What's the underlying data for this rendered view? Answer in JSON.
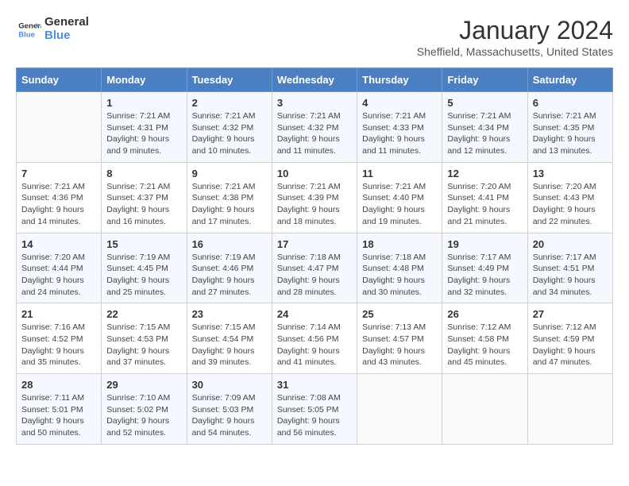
{
  "header": {
    "logo_line1": "General",
    "logo_line2": "Blue",
    "month": "January 2024",
    "location": "Sheffield, Massachusetts, United States"
  },
  "days_of_week": [
    "Sunday",
    "Monday",
    "Tuesday",
    "Wednesday",
    "Thursday",
    "Friday",
    "Saturday"
  ],
  "weeks": [
    [
      {
        "day": "",
        "sunrise": "",
        "sunset": "",
        "daylight": ""
      },
      {
        "day": "1",
        "sunrise": "Sunrise: 7:21 AM",
        "sunset": "Sunset: 4:31 PM",
        "daylight": "Daylight: 9 hours and 9 minutes."
      },
      {
        "day": "2",
        "sunrise": "Sunrise: 7:21 AM",
        "sunset": "Sunset: 4:32 PM",
        "daylight": "Daylight: 9 hours and 10 minutes."
      },
      {
        "day": "3",
        "sunrise": "Sunrise: 7:21 AM",
        "sunset": "Sunset: 4:32 PM",
        "daylight": "Daylight: 9 hours and 11 minutes."
      },
      {
        "day": "4",
        "sunrise": "Sunrise: 7:21 AM",
        "sunset": "Sunset: 4:33 PM",
        "daylight": "Daylight: 9 hours and 11 minutes."
      },
      {
        "day": "5",
        "sunrise": "Sunrise: 7:21 AM",
        "sunset": "Sunset: 4:34 PM",
        "daylight": "Daylight: 9 hours and 12 minutes."
      },
      {
        "day": "6",
        "sunrise": "Sunrise: 7:21 AM",
        "sunset": "Sunset: 4:35 PM",
        "daylight": "Daylight: 9 hours and 13 minutes."
      }
    ],
    [
      {
        "day": "7",
        "sunrise": "Sunrise: 7:21 AM",
        "sunset": "Sunset: 4:36 PM",
        "daylight": "Daylight: 9 hours and 14 minutes."
      },
      {
        "day": "8",
        "sunrise": "Sunrise: 7:21 AM",
        "sunset": "Sunset: 4:37 PM",
        "daylight": "Daylight: 9 hours and 16 minutes."
      },
      {
        "day": "9",
        "sunrise": "Sunrise: 7:21 AM",
        "sunset": "Sunset: 4:38 PM",
        "daylight": "Daylight: 9 hours and 17 minutes."
      },
      {
        "day": "10",
        "sunrise": "Sunrise: 7:21 AM",
        "sunset": "Sunset: 4:39 PM",
        "daylight": "Daylight: 9 hours and 18 minutes."
      },
      {
        "day": "11",
        "sunrise": "Sunrise: 7:21 AM",
        "sunset": "Sunset: 4:40 PM",
        "daylight": "Daylight: 9 hours and 19 minutes."
      },
      {
        "day": "12",
        "sunrise": "Sunrise: 7:20 AM",
        "sunset": "Sunset: 4:41 PM",
        "daylight": "Daylight: 9 hours and 21 minutes."
      },
      {
        "day": "13",
        "sunrise": "Sunrise: 7:20 AM",
        "sunset": "Sunset: 4:43 PM",
        "daylight": "Daylight: 9 hours and 22 minutes."
      }
    ],
    [
      {
        "day": "14",
        "sunrise": "Sunrise: 7:20 AM",
        "sunset": "Sunset: 4:44 PM",
        "daylight": "Daylight: 9 hours and 24 minutes."
      },
      {
        "day": "15",
        "sunrise": "Sunrise: 7:19 AM",
        "sunset": "Sunset: 4:45 PM",
        "daylight": "Daylight: 9 hours and 25 minutes."
      },
      {
        "day": "16",
        "sunrise": "Sunrise: 7:19 AM",
        "sunset": "Sunset: 4:46 PM",
        "daylight": "Daylight: 9 hours and 27 minutes."
      },
      {
        "day": "17",
        "sunrise": "Sunrise: 7:18 AM",
        "sunset": "Sunset: 4:47 PM",
        "daylight": "Daylight: 9 hours and 28 minutes."
      },
      {
        "day": "18",
        "sunrise": "Sunrise: 7:18 AM",
        "sunset": "Sunset: 4:48 PM",
        "daylight": "Daylight: 9 hours and 30 minutes."
      },
      {
        "day": "19",
        "sunrise": "Sunrise: 7:17 AM",
        "sunset": "Sunset: 4:49 PM",
        "daylight": "Daylight: 9 hours and 32 minutes."
      },
      {
        "day": "20",
        "sunrise": "Sunrise: 7:17 AM",
        "sunset": "Sunset: 4:51 PM",
        "daylight": "Daylight: 9 hours and 34 minutes."
      }
    ],
    [
      {
        "day": "21",
        "sunrise": "Sunrise: 7:16 AM",
        "sunset": "Sunset: 4:52 PM",
        "daylight": "Daylight: 9 hours and 35 minutes."
      },
      {
        "day": "22",
        "sunrise": "Sunrise: 7:15 AM",
        "sunset": "Sunset: 4:53 PM",
        "daylight": "Daylight: 9 hours and 37 minutes."
      },
      {
        "day": "23",
        "sunrise": "Sunrise: 7:15 AM",
        "sunset": "Sunset: 4:54 PM",
        "daylight": "Daylight: 9 hours and 39 minutes."
      },
      {
        "day": "24",
        "sunrise": "Sunrise: 7:14 AM",
        "sunset": "Sunset: 4:56 PM",
        "daylight": "Daylight: 9 hours and 41 minutes."
      },
      {
        "day": "25",
        "sunrise": "Sunrise: 7:13 AM",
        "sunset": "Sunset: 4:57 PM",
        "daylight": "Daylight: 9 hours and 43 minutes."
      },
      {
        "day": "26",
        "sunrise": "Sunrise: 7:12 AM",
        "sunset": "Sunset: 4:58 PM",
        "daylight": "Daylight: 9 hours and 45 minutes."
      },
      {
        "day": "27",
        "sunrise": "Sunrise: 7:12 AM",
        "sunset": "Sunset: 4:59 PM",
        "daylight": "Daylight: 9 hours and 47 minutes."
      }
    ],
    [
      {
        "day": "28",
        "sunrise": "Sunrise: 7:11 AM",
        "sunset": "Sunset: 5:01 PM",
        "daylight": "Daylight: 9 hours and 50 minutes."
      },
      {
        "day": "29",
        "sunrise": "Sunrise: 7:10 AM",
        "sunset": "Sunset: 5:02 PM",
        "daylight": "Daylight: 9 hours and 52 minutes."
      },
      {
        "day": "30",
        "sunrise": "Sunrise: 7:09 AM",
        "sunset": "Sunset: 5:03 PM",
        "daylight": "Daylight: 9 hours and 54 minutes."
      },
      {
        "day": "31",
        "sunrise": "Sunrise: 7:08 AM",
        "sunset": "Sunset: 5:05 PM",
        "daylight": "Daylight: 9 hours and 56 minutes."
      },
      {
        "day": "",
        "sunrise": "",
        "sunset": "",
        "daylight": ""
      },
      {
        "day": "",
        "sunrise": "",
        "sunset": "",
        "daylight": ""
      },
      {
        "day": "",
        "sunrise": "",
        "sunset": "",
        "daylight": ""
      }
    ]
  ]
}
